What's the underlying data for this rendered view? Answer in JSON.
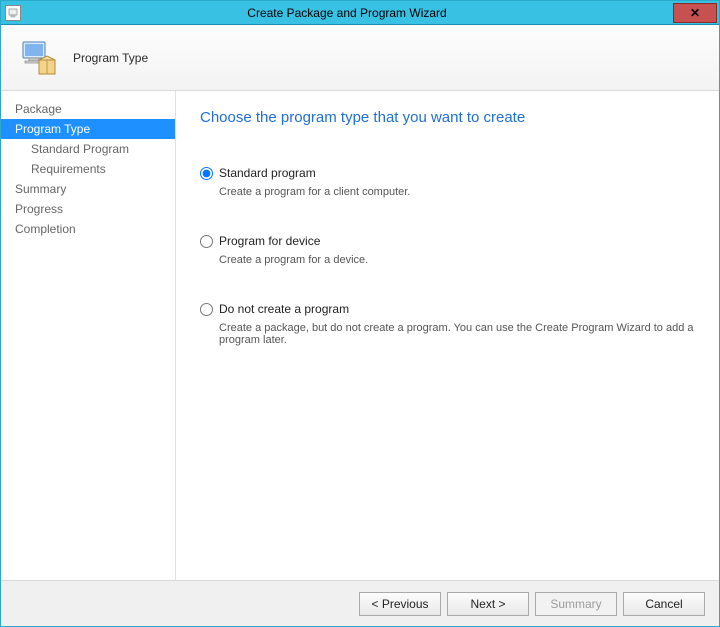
{
  "window": {
    "title": "Create Package and Program Wizard"
  },
  "header": {
    "title": "Program Type"
  },
  "sidebar": {
    "items": [
      {
        "label": "Package",
        "indent": 0,
        "selected": false
      },
      {
        "label": "Program Type",
        "indent": 0,
        "selected": true
      },
      {
        "label": "Standard Program",
        "indent": 1,
        "selected": false
      },
      {
        "label": "Requirements",
        "indent": 1,
        "selected": false
      },
      {
        "label": "Summary",
        "indent": 0,
        "selected": false
      },
      {
        "label": "Progress",
        "indent": 0,
        "selected": false
      },
      {
        "label": "Completion",
        "indent": 0,
        "selected": false
      }
    ]
  },
  "content": {
    "heading": "Choose the program type that you want to create",
    "options": [
      {
        "label": "Standard program",
        "description": "Create a program for a client computer.",
        "checked": true
      },
      {
        "label": "Program for device",
        "description": "Create a program for a device.",
        "checked": false
      },
      {
        "label": "Do not create a program",
        "description": "Create a package, but do not create a program. You can use the Create Program Wizard to add a program later.",
        "checked": false
      }
    ]
  },
  "footer": {
    "previous": "< Previous",
    "next": "Next >",
    "summary": "Summary",
    "cancel": "Cancel",
    "summary_enabled": false
  },
  "glyphs": {
    "close": "✕"
  }
}
